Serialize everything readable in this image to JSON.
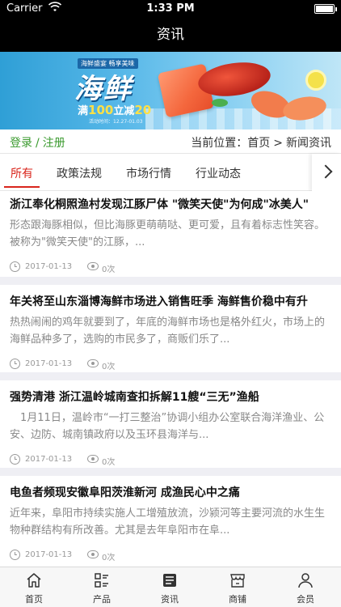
{
  "status_bar": {
    "carrier": "Carrier",
    "time": "1:33 PM"
  },
  "header": {
    "title": "资讯"
  },
  "banner": {
    "tagline": "海鲜盛宴 畅享美味",
    "headline": "海鲜",
    "promo_prefix": "满",
    "promo_threshold": "100",
    "promo_middle": "立减",
    "promo_discount": "20",
    "date": "活动时间：12.27-01.03"
  },
  "breadcrumb": {
    "login": "登录",
    "separator": "/",
    "register": "注册",
    "location_label": "当前位置：",
    "home": "首页",
    "arrow": ">",
    "current": "新闻资讯"
  },
  "tabs": [
    {
      "label": "所有",
      "active": true
    },
    {
      "label": "政策法规",
      "active": false
    },
    {
      "label": "市场行情",
      "active": false
    },
    {
      "label": "行业动态",
      "active": false
    }
  ],
  "articles": [
    {
      "title": "浙江奉化桐照渔村发现江豚尸体 \"微笑天使\"为何成\"冰美人\"",
      "summary": "形态跟海豚相似，但比海豚更萌萌哒、更可爱，且有着标志性笑容。被称为\"微笑天使\"的江豚，...",
      "date": "2017-01-13",
      "views": "0次"
    },
    {
      "title": "年关将至山东淄博海鲜市场进入销售旺季 海鲜售价稳中有升",
      "summary": "热热闹闹的鸡年就要到了，年底的海鲜市场也是格外红火，市场上的海鲜品种多了，选购的市民多了，商贩们乐了...",
      "date": "2017-01-13",
      "views": "0次"
    },
    {
      "title": "强势清港 浙江温岭城南查扣拆解11艘“三无”渔船",
      "summary": "　1月11日，温岭市“一打三整治”协调小组办公室联合海洋渔业、公安、边防、城南镇政府以及玉环县海洋与...",
      "date": "2017-01-13",
      "views": "0次"
    },
    {
      "title": "电鱼者频现安徽阜阳茨淮新河 成渔民心中之痛",
      "summary": "近年来，阜阳市持续实施人工增殖放流，沙颍河等主要河流的水生生物种群结构有所改善。尤其是去年阜阳市在阜...",
      "date": "2017-01-13",
      "views": "0次"
    }
  ],
  "tabbar": [
    {
      "label": "首页",
      "icon": "home-icon"
    },
    {
      "label": "产品",
      "icon": "product-list-icon"
    },
    {
      "label": "资讯",
      "icon": "news-icon"
    },
    {
      "label": "商铺",
      "icon": "shop-icon"
    },
    {
      "label": "会员",
      "icon": "member-icon"
    }
  ],
  "colors": {
    "accent_red": "#d9251c",
    "login_green": "#3a9a2e",
    "header_bg": "#000000"
  }
}
